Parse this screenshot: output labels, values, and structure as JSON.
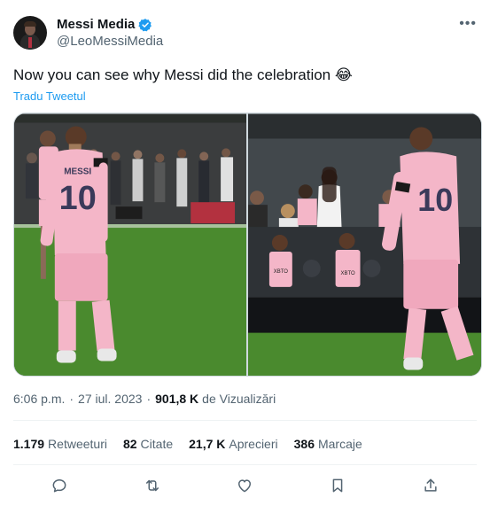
{
  "author": {
    "display_name": "Messi Media",
    "handle": "@LeoMessiMedia",
    "verified": true
  },
  "tweet": {
    "text": "Now you can see why Messi did the celebration 😂",
    "translate_label": "Tradu Tweetul"
  },
  "media": {
    "photos": [
      {
        "jersey_name": "MESSI",
        "jersey_number": "10"
      },
      {
        "jersey_number": "10",
        "stand_text": "XBTO"
      }
    ]
  },
  "meta": {
    "time": "6:06 p.m.",
    "separator": "·",
    "date": "27 iul. 2023",
    "views_count": "901,8 K",
    "views_label": "de Vizualizări"
  },
  "stats": {
    "retweets_count": "1.179",
    "retweets_label": "Retweeturi",
    "quotes_count": "82",
    "quotes_label": "Citate",
    "likes_count": "21,7 K",
    "likes_label": "Aprecieri",
    "bookmarks_count": "386",
    "bookmarks_label": "Marcaje"
  },
  "actions": [
    "reply-icon",
    "retweet-icon",
    "like-icon",
    "bookmark-icon",
    "share-icon"
  ],
  "colors": {
    "accent": "#1d9bf0",
    "text": "#0f1419",
    "secondary": "#536471",
    "jersey": "#f4b6c8",
    "pitch": "#4a8a2e"
  }
}
